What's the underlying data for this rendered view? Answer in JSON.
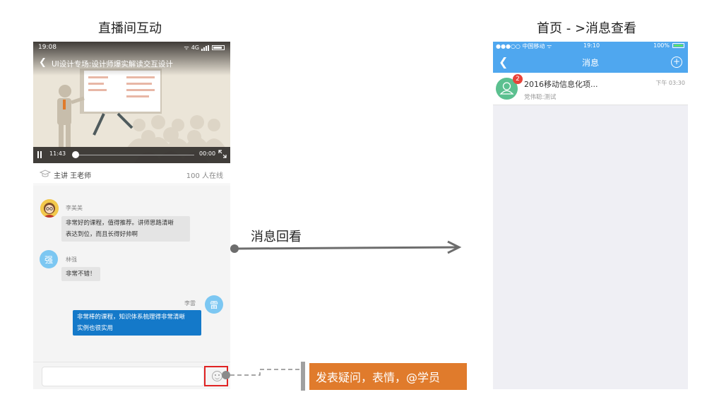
{
  "headings": {
    "left": "直播间互动",
    "right": "首页 - >消息查看"
  },
  "live": {
    "status_time": "19:08",
    "network": "4G",
    "video_title": "UI设计专场:设计师爆实解读交互设计",
    "current_time": "11:43",
    "end_time": "00:00",
    "progress": 0.0,
    "teacher_label": "主讲 王老师",
    "online": "100 人在线",
    "messages": [
      {
        "sender": "李美美",
        "text_lines": [
          "非常好的课程，值得推荐。讲师思路清晰",
          "表达到位，而且长得好帅啊"
        ],
        "side": "in",
        "avatar": "photo"
      },
      {
        "sender": "林强",
        "avatar_letter": "强",
        "text_lines": [
          "非常不错！"
        ],
        "side": "in"
      },
      {
        "sender": "李雷",
        "avatar_letter": "雷",
        "text_lines": [
          "非常棒的课程，知识体系梳理得非常清晰",
          "实例也很实用"
        ],
        "side": "out"
      }
    ],
    "input_placeholder": ""
  },
  "annotation": {
    "label": "发表疑问，表情，@学员",
    "color": "#e07b2c"
  },
  "arrow": {
    "label": "消息回看"
  },
  "messages_page": {
    "carrier": "●●●○○ 中国移动 ᯤ",
    "time": "19:10",
    "battery": "100%",
    "title": "消息",
    "header_color": "#4fa7ef",
    "item": {
      "badge": "2",
      "title": "2016移动信息化项...",
      "time": "下午 03:30",
      "subtitle": "党伟聪:测试"
    }
  }
}
